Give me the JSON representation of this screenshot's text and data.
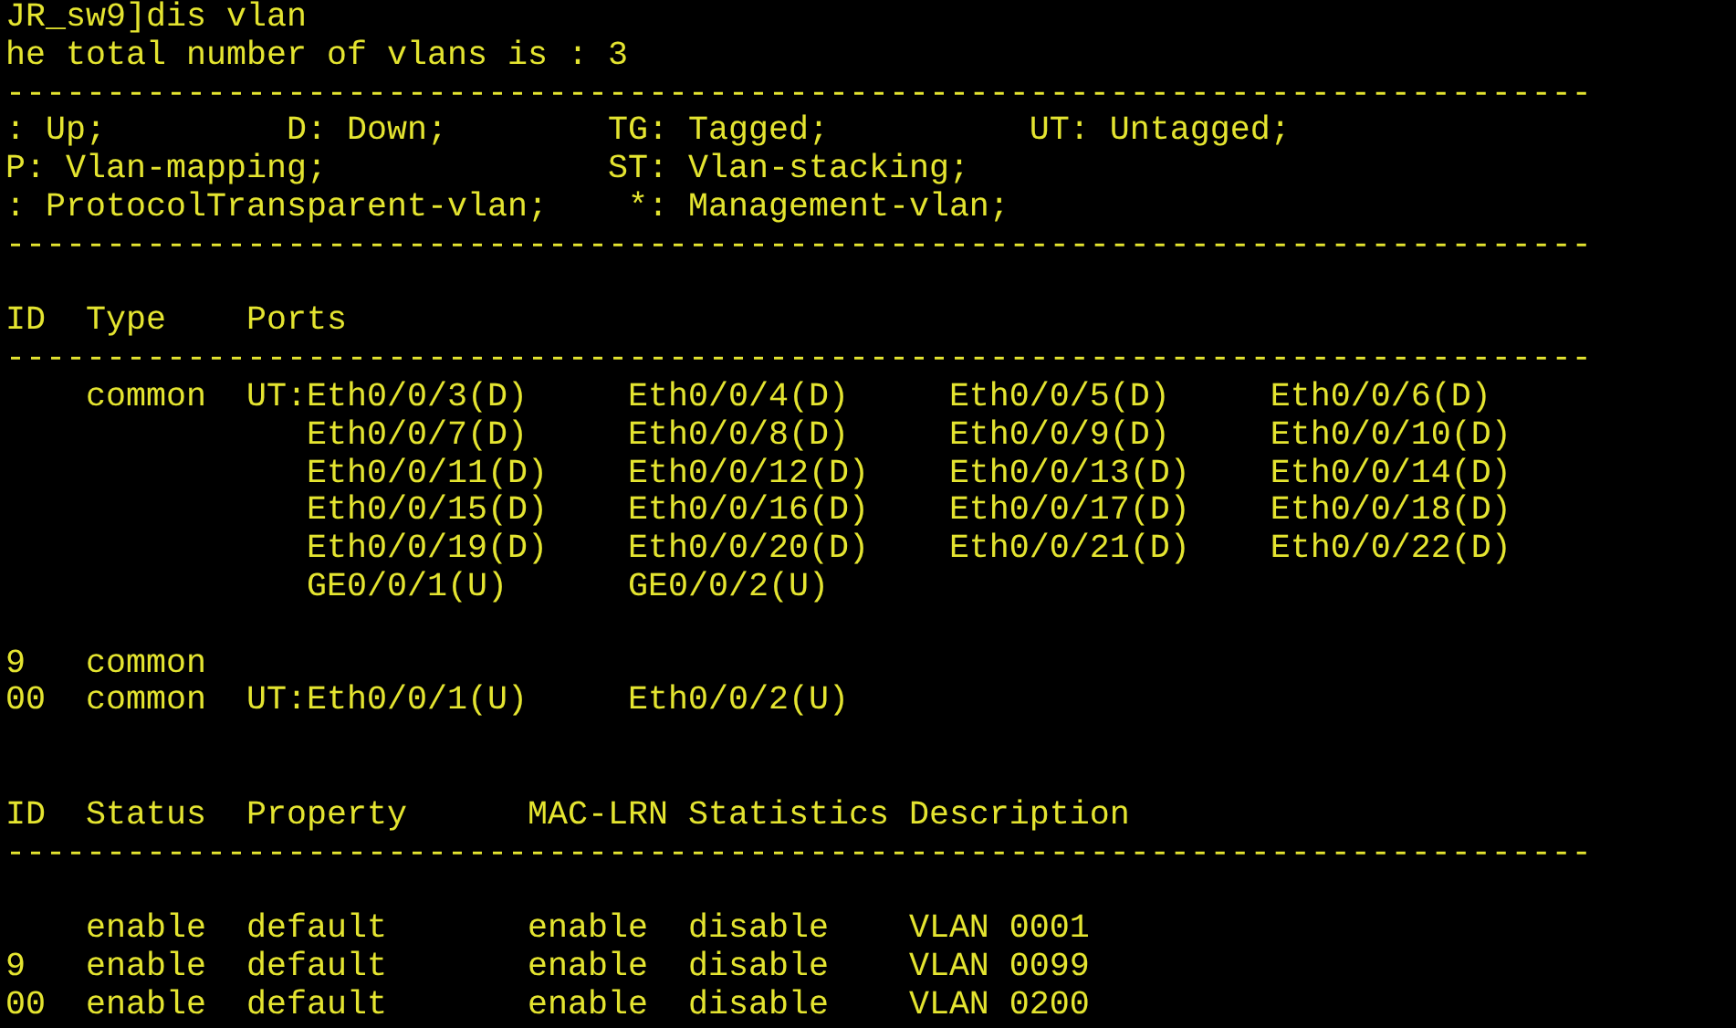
{
  "terminal": {
    "lines": [
      {
        "kind": "text",
        "text": "JR_sw9]dis vlan"
      },
      {
        "kind": "text",
        "text": "he total number of vlans is : 3"
      },
      {
        "kind": "text",
        "text": "-------------------------------------------------------------------------------"
      },
      {
        "kind": "text",
        "text": ": Up;         D: Down;        TG: Tagged;          UT: Untagged;"
      },
      {
        "kind": "text",
        "text": "P: Vlan-mapping;              ST: Vlan-stacking;"
      },
      {
        "kind": "text",
        "text": ": ProtocolTransparent-vlan;    *: Management-vlan;"
      },
      {
        "kind": "text",
        "text": "-------------------------------------------------------------------------------"
      },
      {
        "kind": "blank"
      },
      {
        "kind": "text",
        "text": "ID  Type    Ports"
      },
      {
        "kind": "text",
        "text": "-------------------------------------------------------------------------------"
      },
      {
        "kind": "text",
        "text": "    common  UT:Eth0/0/3(D)     Eth0/0/4(D)     Eth0/0/5(D)     Eth0/0/6(D)"
      },
      {
        "kind": "text",
        "text": "               Eth0/0/7(D)     Eth0/0/8(D)     Eth0/0/9(D)     Eth0/0/10(D)"
      },
      {
        "kind": "text",
        "text": "               Eth0/0/11(D)    Eth0/0/12(D)    Eth0/0/13(D)    Eth0/0/14(D)"
      },
      {
        "kind": "text",
        "text": "               Eth0/0/15(D)    Eth0/0/16(D)    Eth0/0/17(D)    Eth0/0/18(D)"
      },
      {
        "kind": "text",
        "text": "               Eth0/0/19(D)    Eth0/0/20(D)    Eth0/0/21(D)    Eth0/0/22(D)"
      },
      {
        "kind": "text",
        "text": "               GE0/0/1(U)      GE0/0/2(U)"
      },
      {
        "kind": "blank"
      },
      {
        "kind": "text",
        "text": "9   common"
      },
      {
        "kind": "text",
        "text": "00  common  UT:Eth0/0/1(U)     Eth0/0/2(U)"
      },
      {
        "kind": "blank"
      },
      {
        "kind": "blank"
      },
      {
        "kind": "text",
        "text": "ID  Status  Property      MAC-LRN Statistics Description"
      },
      {
        "kind": "text",
        "text": "-------------------------------------------------------------------------------"
      },
      {
        "kind": "blank"
      },
      {
        "kind": "text",
        "text": "    enable  default       enable  disable    VLAN 0001"
      },
      {
        "kind": "text",
        "text": "9   enable  default       enable  disable    VLAN 0099"
      },
      {
        "kind": "text",
        "text": "00  enable  default       enable  disable    VLAN 0200"
      }
    ]
  }
}
